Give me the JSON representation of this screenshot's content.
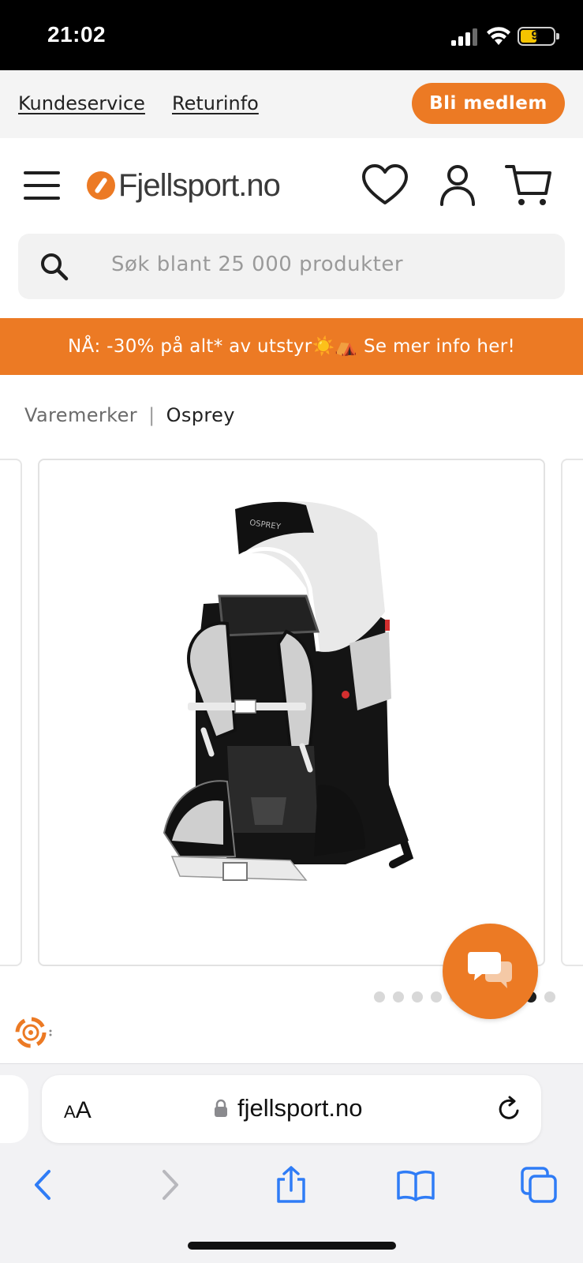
{
  "status_bar": {
    "time": "21:02",
    "battery_level": "9"
  },
  "top_links": {
    "customer_service": "Kundeservice",
    "return_info": "Returinfo",
    "member_button": "Bli medlem"
  },
  "header": {
    "logo_text": "Fjellsport.no"
  },
  "search": {
    "placeholder": "Søk blant 25 000 produkter"
  },
  "promo": {
    "text": "NÅ: -30% på alt* av utstyr☀️⛺ Se mer info her!"
  },
  "breadcrumb": {
    "brands": "Varemerker",
    "separator": "|",
    "current": "Osprey"
  },
  "gallery": {
    "image_count": 10,
    "active_index": 8
  },
  "browser": {
    "aa_small": "A",
    "aa_big": "A",
    "url": "fjellsport.no"
  },
  "colors": {
    "accent": "#ec7a24",
    "ios_blue": "#2f7cf6"
  }
}
